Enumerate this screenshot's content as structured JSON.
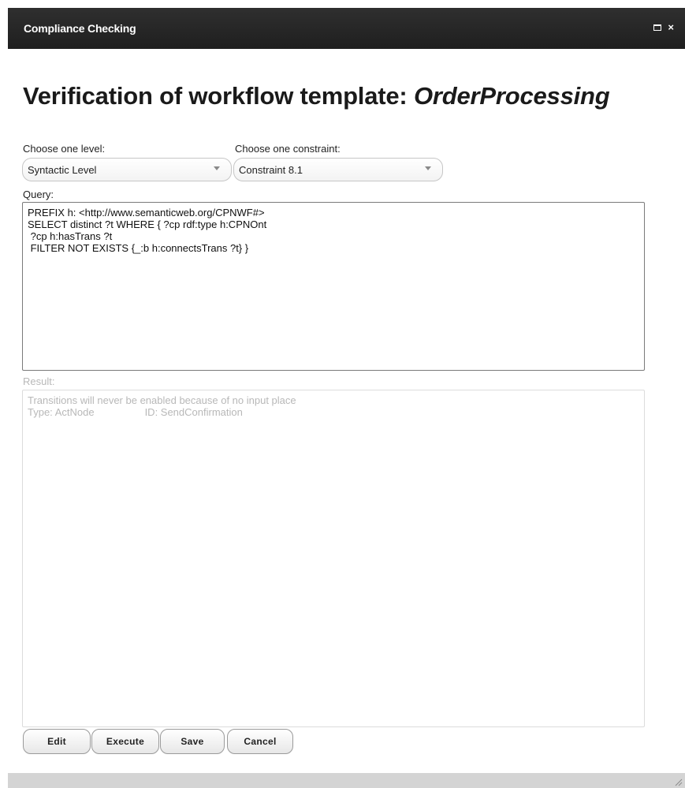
{
  "window": {
    "title": "Compliance Checking",
    "maximize_icon": "maximize-icon",
    "close_symbol": "×"
  },
  "heading": {
    "prefix": "Verification of workflow template: ",
    "template_name": "OrderProcessing"
  },
  "level": {
    "label": "Choose one level:",
    "selected": "Syntactic Level"
  },
  "constraint": {
    "label": "Choose one constraint:",
    "selected": "Constraint 8.1"
  },
  "query": {
    "label": "Query:",
    "text": "PREFIX h: <http://www.semanticweb.org/CPNWF#>\nSELECT distinct ?t WHERE { ?cp rdf:type h:CPNOnt\n ?cp h:hasTrans ?t\n FILTER NOT EXISTS {_:b h:connectsTrans ?t} }"
  },
  "result": {
    "label": "Result:",
    "message": "Transitions will never be enabled because of no input place",
    "type_text": "Type: ActNode",
    "id_text": "ID: SendConfirmation"
  },
  "buttons": {
    "edit": "Edit",
    "execute": "Execute",
    "save": "Save",
    "cancel": "Cancel"
  },
  "colors": {
    "titlebar": "#262626",
    "disabled_text": "#b8b8b8",
    "statusbar": "#d4d4d4"
  }
}
